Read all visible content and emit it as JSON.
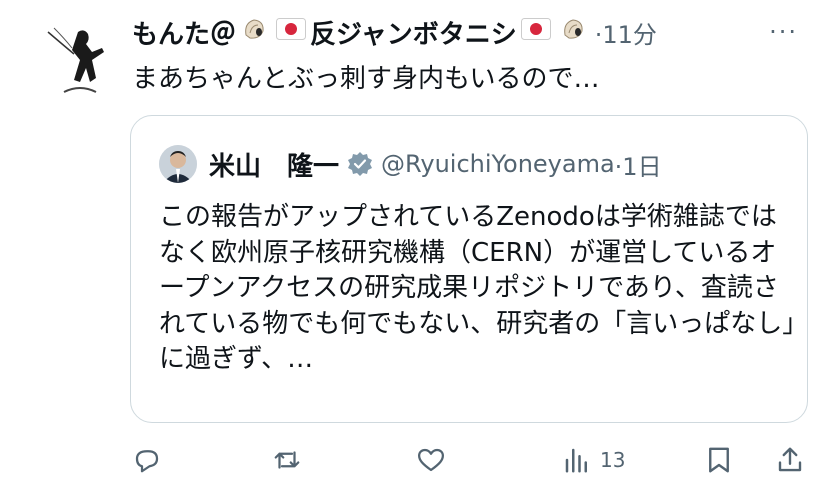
{
  "post": {
    "author_name": "もんた＠",
    "author_name_suffix": "反ジャンボタニシ",
    "time": "·11分",
    "more_label": "···",
    "text": "まあちゃんとぶっ刺す身内もいるので…"
  },
  "quote": {
    "author_name": "米山　隆一",
    "handle": "@RyuichiYoneyama",
    "time": "·1日",
    "text": "この報告がアップされているZenodoは学術雑誌ではなく欧州原子核研究機構（CERN）が運営しているオープンアクセスの研究成果リポジトリであり、査読されている物でも何でもない、研究者の「言いっぱなし」に過ぎず、…"
  },
  "actions": {
    "views_count": "13"
  },
  "colors": {
    "text": "#0f1419",
    "secondary": "#536471",
    "border": "#cfd9de",
    "verified": "#829aab"
  }
}
